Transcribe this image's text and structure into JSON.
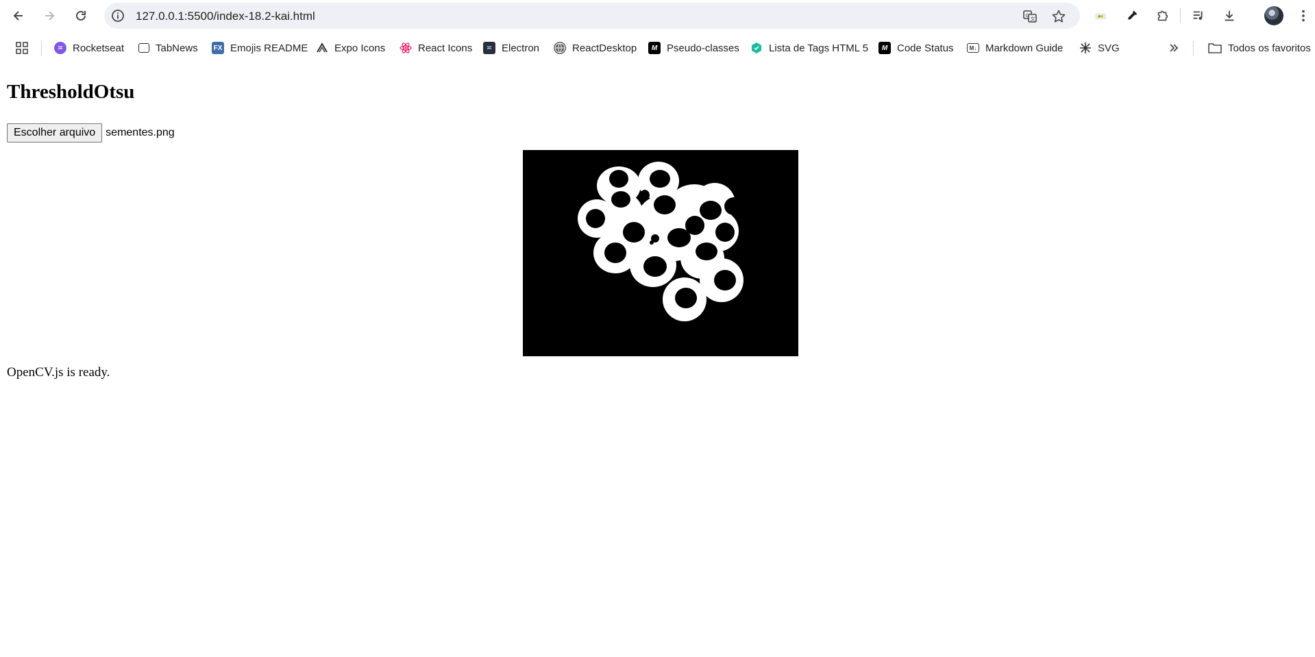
{
  "browser": {
    "url_host": "127.0.0.1",
    "url_rest": ":5500/index-18.2-kai.html",
    "icons": {
      "back": "arrow-left-icon",
      "forward": "arrow-right-icon",
      "reload": "reload-icon",
      "site_info": "info-icon",
      "translate": "translate-icon",
      "bookmark": "star-icon",
      "extension_1": "extension-icon",
      "eyedropper": "eyedropper-icon",
      "extensions": "puzzle-icon",
      "media": "media-playlist-icon",
      "downloads": "download-icon",
      "profile": "avatar",
      "menu": "kebab-menu-icon"
    }
  },
  "bookmarks": {
    "items": [
      {
        "label": "Rocketseat",
        "icon": "rocketseat-icon",
        "color": "#8257e5"
      },
      {
        "label": "TabNews",
        "icon": "tabnews-icon",
        "color": "#24292f"
      },
      {
        "label": "Emojis README",
        "icon": "fx-icon",
        "color": "#3d6ea8"
      },
      {
        "label": "Expo Icons",
        "icon": "expo-icon",
        "color": "#333333"
      },
      {
        "label": "React Icons",
        "icon": "react-icon",
        "color": "#e91e63"
      },
      {
        "label": "Electron",
        "icon": "electron-icon",
        "color": "#2b2e3a"
      },
      {
        "label": "ReactDesktop",
        "icon": "globe-icon",
        "color": "#5f6368"
      },
      {
        "label": "Pseudo-classes",
        "icon": "mdn-icon",
        "color": "#000000"
      },
      {
        "label": "Lista de Tags HTML 5",
        "icon": "hexagon-icon",
        "color": "#1abc9c"
      },
      {
        "label": "Code Status",
        "icon": "mdn-icon",
        "color": "#000000"
      },
      {
        "label": "Markdown Guide",
        "icon": "markdown-icon",
        "color": "#333333"
      },
      {
        "label": "SVG",
        "icon": "svg-icon",
        "color": "#333333"
      }
    ],
    "overflow_icon": "chevron-double-right-icon",
    "all_bookmarks_label": "Todos os favoritos"
  },
  "page": {
    "title": "ThresholdOtsu",
    "file_button_label": "Escolher arquivo",
    "file_name": "sementes.png",
    "status": "OpenCV.js is ready."
  }
}
